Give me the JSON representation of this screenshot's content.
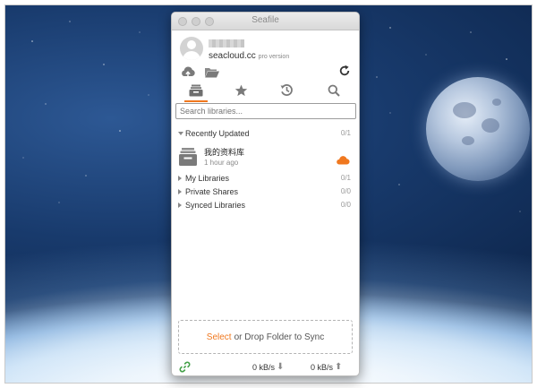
{
  "window": {
    "title": "Seafile"
  },
  "account": {
    "server": "seacloud.cc",
    "edition": "pro version"
  },
  "toolbar": {
    "upload_icon": "cloud-upload-icon",
    "folder_icon": "folder-open-icon",
    "refresh_icon": "refresh-icon"
  },
  "tabs": [
    {
      "icon": "library-icon",
      "active": true
    },
    {
      "icon": "star-icon",
      "active": false
    },
    {
      "icon": "history-icon",
      "active": false
    },
    {
      "icon": "search-icon",
      "active": false
    }
  ],
  "search": {
    "placeholder": "Search libraries..."
  },
  "sections": [
    {
      "label": "Recently Updated",
      "count": "0/1",
      "expanded": true,
      "items": [
        {
          "name": "我的资料库",
          "time": "1 hour ago",
          "status_icon": "cloud-icon"
        }
      ]
    },
    {
      "label": "My Libraries",
      "count": "0/1",
      "expanded": false
    },
    {
      "label": "Private Shares",
      "count": "0/0",
      "expanded": false
    },
    {
      "label": "Synced Libraries",
      "count": "0/0",
      "expanded": false
    }
  ],
  "dropzone": {
    "select_text": "Select",
    "rest_text": "or Drop Folder to Sync"
  },
  "status": {
    "download_rate": "0 kB/s",
    "upload_rate": "0 kB/s",
    "download_arrow": "⬇",
    "upload_arrow": "⬆"
  },
  "colors": {
    "accent": "#f0781f",
    "icon_gray": "#7a7a7a"
  }
}
